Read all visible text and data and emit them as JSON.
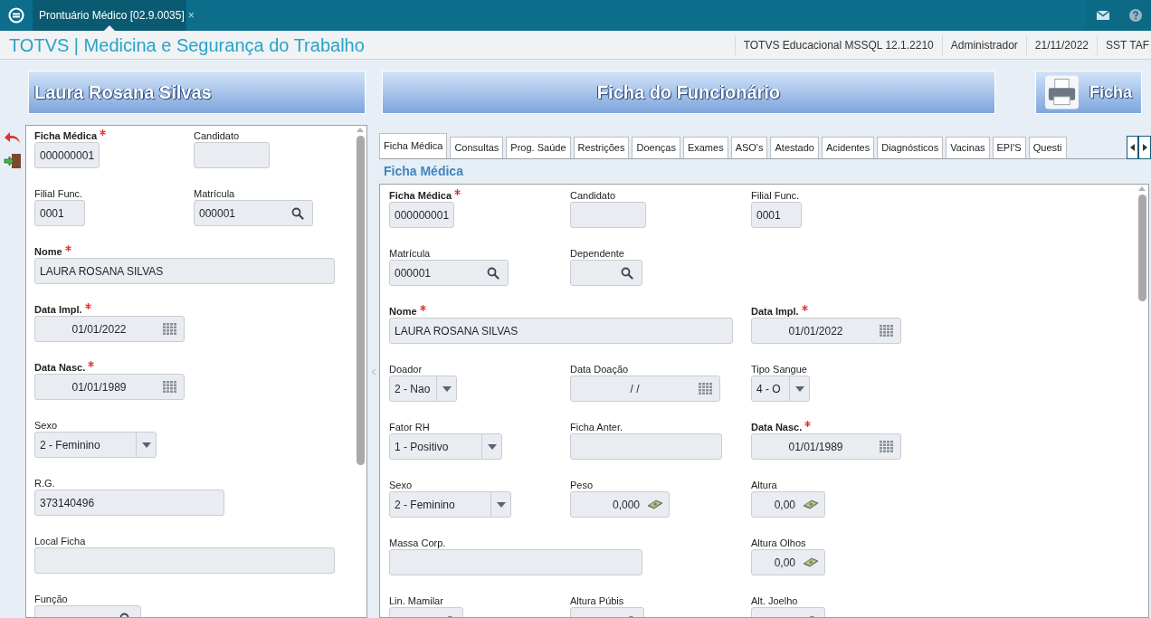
{
  "top_bar": {
    "tab": {
      "title": "Prontuário Médico [02.9.0035]",
      "close": "×"
    }
  },
  "header": {
    "title": "TOTVS | Medicina e Segurança do Trabalho",
    "info": [
      "TOTVS Educacional MSSQL 12.1.2210",
      "Administrador",
      "21/11/2022",
      "SST TAF"
    ]
  },
  "banners": {
    "employee": "Laura Rosana Silvas",
    "title": "Ficha do Funcionário",
    "print_button": "Ficha"
  },
  "left_panel": {
    "rows": [
      [
        {
          "kind": "text",
          "label": "Ficha Médica",
          "required": true,
          "value": "000000001"
        },
        {
          "kind": "text",
          "label": "Candidato",
          "required": false
        }
      ],
      [
        {
          "kind": "text",
          "label": "Filial Func.",
          "required": false,
          "value": "0001"
        },
        {
          "kind": "search",
          "label": "Matrícula",
          "required": false,
          "value": "000001"
        }
      ],
      [
        {
          "kind": "text",
          "label": "Nome",
          "required": true,
          "value": "LAURA ROSANA SILVAS"
        }
      ],
      [
        {
          "kind": "date",
          "label": "Data Impl.",
          "required": true,
          "value": "01/01/2022"
        }
      ],
      [
        {
          "kind": "date",
          "label": "Data Nasc.",
          "required": true,
          "value": "01/01/1989"
        }
      ],
      [
        {
          "kind": "select",
          "label": "Sexo",
          "required": false,
          "value": "2 - Feminino"
        }
      ],
      [
        {
          "kind": "text",
          "label": "R.G.",
          "required": false,
          "value": "373140496"
        }
      ],
      [
        {
          "kind": "text",
          "label": "Local Ficha",
          "required": false
        }
      ],
      [
        {
          "kind": "search",
          "label": "Função",
          "required": false
        }
      ]
    ]
  },
  "tabs": [
    {
      "label": "Ficha Médica",
      "selected": true
    },
    {
      "label": "Consultas",
      "selected": false
    },
    {
      "label": "Prog. Saúde",
      "selected": false
    },
    {
      "label": "Restrições",
      "selected": false
    },
    {
      "label": "Doenças",
      "selected": false
    },
    {
      "label": "Exames",
      "selected": false
    },
    {
      "label": "ASO's",
      "selected": false
    },
    {
      "label": "Atestado",
      "selected": false
    },
    {
      "label": "Acidentes",
      "selected": false
    },
    {
      "label": "Diagnósticos",
      "selected": false
    },
    {
      "label": "Vacinas",
      "selected": false
    },
    {
      "label": "EPI'S",
      "selected": false
    },
    {
      "label": "Questi",
      "selected": false
    }
  ],
  "right_panel": {
    "section_title": "Ficha Médica",
    "rows": [
      [
        {
          "kind": "text",
          "label": "Ficha Médica",
          "required": true,
          "value": "000000001"
        },
        {
          "kind": "text",
          "label": "Candidato",
          "required": false
        },
        {
          "kind": "text",
          "label": "Filial Func.",
          "required": false,
          "value": "0001"
        }
      ],
      [
        {
          "kind": "search",
          "label": "Matrícula",
          "required": false,
          "value": "000001"
        },
        {
          "kind": "search",
          "label": "Dependente",
          "required": false
        }
      ],
      [
        {
          "kind": "text",
          "label": "Nome",
          "required": true,
          "value": "LAURA ROSANA SILVAS"
        },
        {
          "kind": "date",
          "label": "Data Impl.",
          "required": true,
          "value": "01/01/2022"
        }
      ],
      [
        {
          "kind": "select",
          "label": "Doador",
          "required": false,
          "value": "2 - Nao"
        },
        {
          "kind": "date",
          "label": "Data Doação",
          "required": false,
          "value": "/ /"
        },
        {
          "kind": "select",
          "label": "Tipo Sangue",
          "required": false,
          "value": "4 - O"
        }
      ],
      [
        {
          "kind": "select",
          "label": "Fator RH",
          "required": false,
          "value": "1 - Positivo"
        },
        {
          "kind": "text",
          "label": "Ficha Anter.",
          "required": false
        },
        {
          "kind": "date",
          "label": "Data Nasc.",
          "required": true,
          "value": "01/01/1989"
        }
      ],
      [
        {
          "kind": "select",
          "label": "Sexo",
          "required": false,
          "value": "2 - Feminino"
        },
        {
          "kind": "number",
          "label": "Peso",
          "required": false,
          "value": "0,000"
        },
        {
          "kind": "number",
          "label": "Altura",
          "required": false,
          "value": "0,00"
        }
      ],
      [
        {
          "kind": "text",
          "label": "Massa Corp.",
          "required": false
        },
        {
          "kind": "number",
          "label": "Altura Olhos",
          "required": false,
          "value": "0,00"
        }
      ],
      [
        {
          "kind": "number",
          "label": "Lin. Mamilar",
          "required": false
        },
        {
          "kind": "number",
          "label": "Altura Púbis",
          "required": false
        },
        {
          "kind": "number",
          "label": "Alt. Joelho",
          "required": false
        }
      ]
    ]
  }
}
